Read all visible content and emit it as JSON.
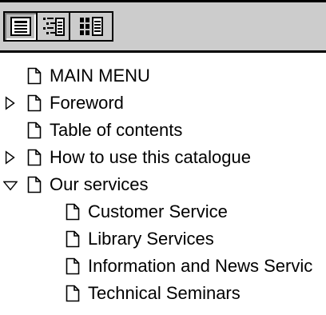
{
  "toolbar": {
    "buttons": [
      {
        "icon": "single-page-view-icon",
        "active": true
      },
      {
        "icon": "outline-view-icon",
        "active": false
      },
      {
        "icon": "thumbnail-view-icon",
        "active": false
      }
    ]
  },
  "tree": {
    "items": [
      {
        "label": "MAIN MENU",
        "level": 0,
        "toggle": "none"
      },
      {
        "label": "Foreword",
        "level": 0,
        "toggle": "collapsed"
      },
      {
        "label": "Table of contents",
        "level": 0,
        "toggle": "none"
      },
      {
        "label": "How to use this catalogue",
        "level": 0,
        "toggle": "collapsed"
      },
      {
        "label": "Our services",
        "level": 0,
        "toggle": "expanded"
      },
      {
        "label": "Customer Service",
        "level": 1,
        "toggle": "none"
      },
      {
        "label": "Library Services",
        "level": 1,
        "toggle": "none"
      },
      {
        "label": "Information and News Servic",
        "level": 1,
        "toggle": "none"
      },
      {
        "label": "Technical Seminars",
        "level": 1,
        "toggle": "none"
      }
    ]
  }
}
